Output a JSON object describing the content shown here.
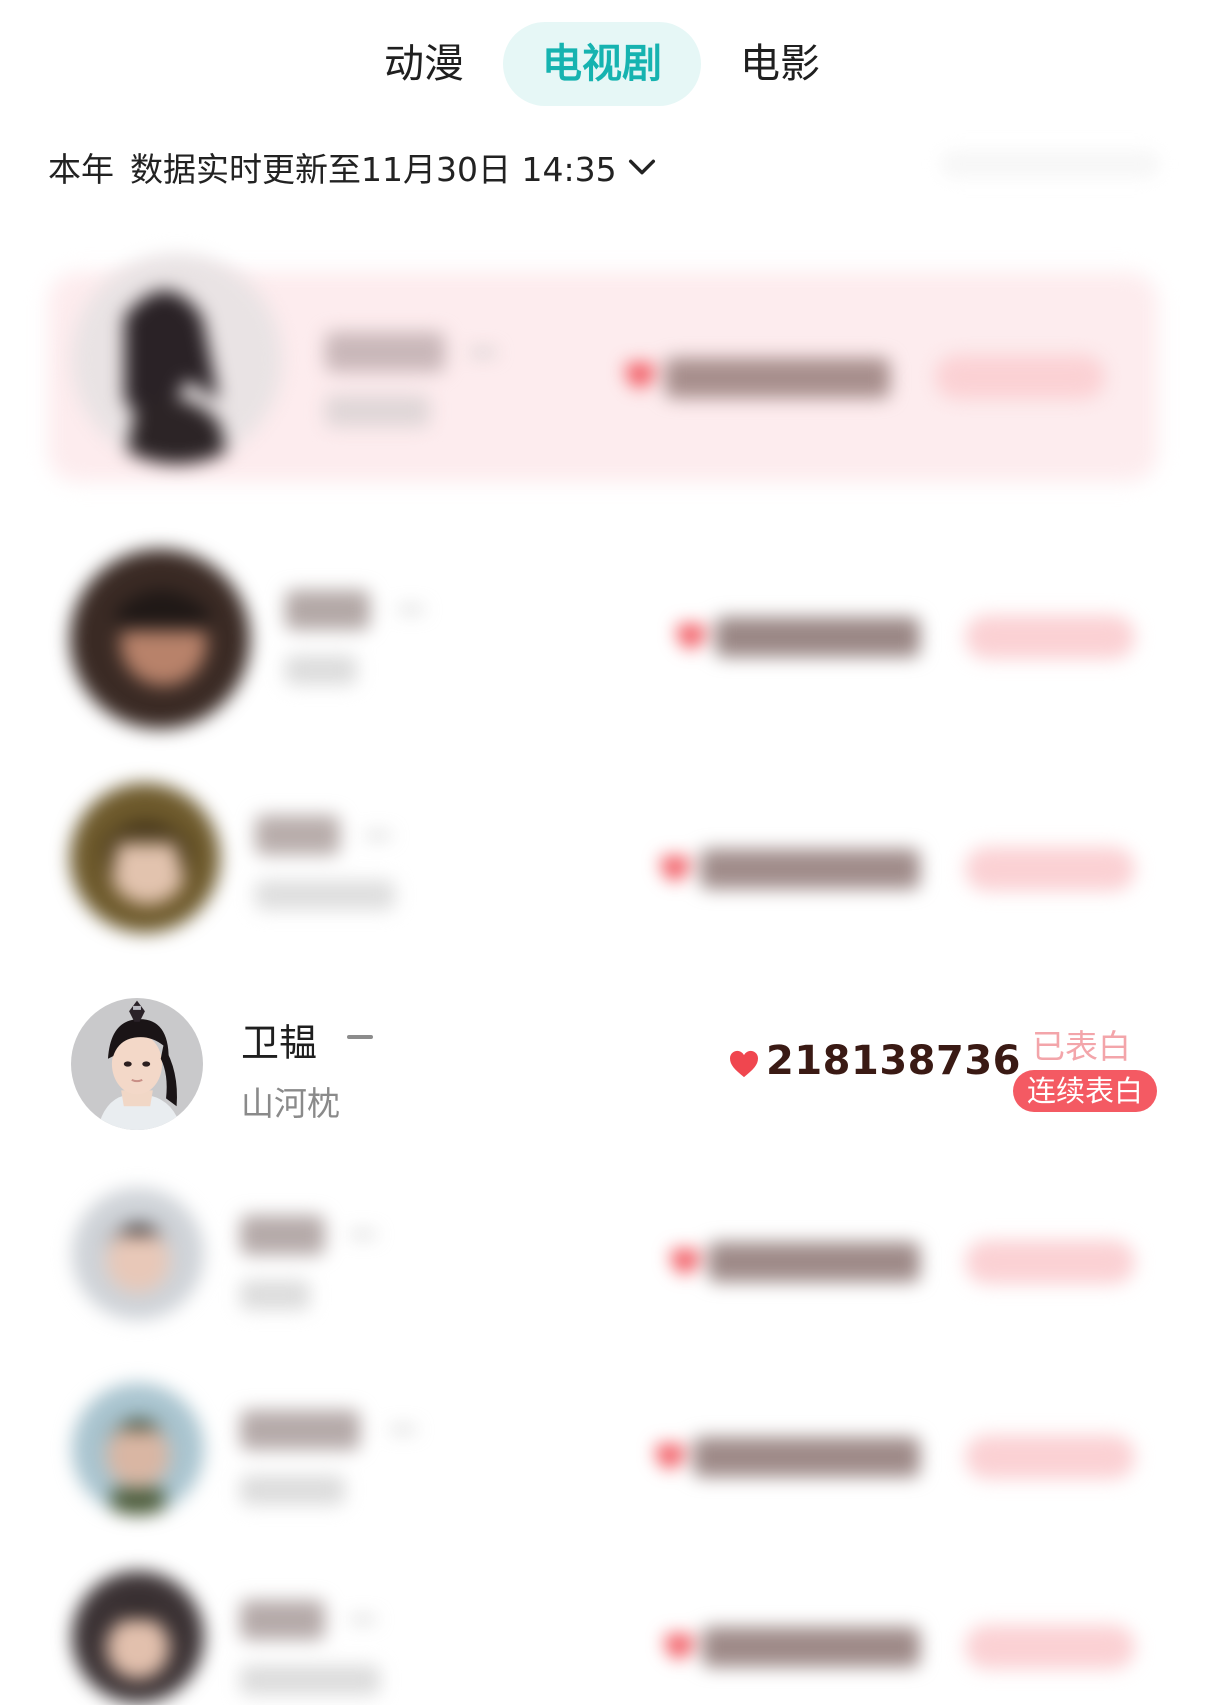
{
  "tabs": [
    {
      "label": "动漫",
      "active": false
    },
    {
      "label": "电视剧",
      "active": true
    },
    {
      "label": "电影",
      "active": false
    }
  ],
  "period": {
    "label": "本年",
    "update_text": "数据实时更新至11月30日 14:35"
  },
  "colors": {
    "accent_teal": "#16b3b0",
    "tab_active_bg": "#e6f7f6",
    "heart_red": "#f0464f",
    "button_red": "#f45a63",
    "confessed_pink": "#f3a5aa",
    "highlight_card": "#fdecee"
  },
  "rows": [
    {
      "name": "",
      "drama": "",
      "votes": "",
      "blurred": true,
      "icon": "heart-icon"
    },
    {
      "name": "",
      "drama": "",
      "votes": "",
      "blurred": true,
      "icon": "heart-icon"
    },
    {
      "name": "",
      "drama": "",
      "votes": "",
      "blurred": true,
      "icon": "heart-icon"
    },
    {
      "name": "卫韫",
      "drama": "山河枕",
      "votes": "218138736",
      "rank_change": "—",
      "status": "已表白",
      "action": "连续表白",
      "blurred": false,
      "icon": "heart-icon"
    },
    {
      "name": "",
      "drama": "",
      "votes": "",
      "blurred": true,
      "icon": "heart-icon"
    },
    {
      "name": "",
      "drama": "",
      "votes": "",
      "blurred": true,
      "icon": "heart-icon"
    },
    {
      "name": "",
      "drama": "",
      "votes": "",
      "blurred": true,
      "icon": "heart-icon"
    }
  ]
}
